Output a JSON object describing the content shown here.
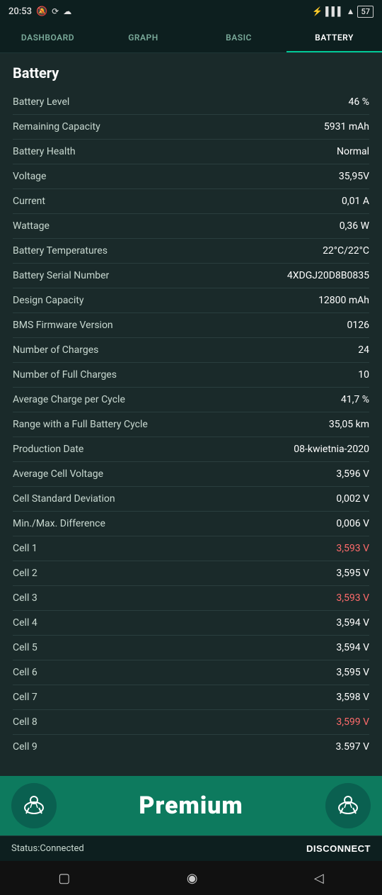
{
  "statusBar": {
    "time": "20:53",
    "batteryPercent": "57"
  },
  "tabs": [
    {
      "id": "dashboard",
      "label": "DASHBOARD",
      "active": false
    },
    {
      "id": "graph",
      "label": "GRAPH",
      "active": false
    },
    {
      "id": "basic",
      "label": "BASIC",
      "active": false
    },
    {
      "id": "battery",
      "label": "BATTERY",
      "active": true
    }
  ],
  "section": {
    "title": "Battery"
  },
  "rows": [
    {
      "label": "Battery Level",
      "value": "46 %",
      "highlight": ""
    },
    {
      "label": "Remaining Capacity",
      "value": "5931 mAh",
      "highlight": ""
    },
    {
      "label": "Battery Health",
      "value": "Normal",
      "highlight": ""
    },
    {
      "label": "Voltage",
      "value": "35,95V",
      "highlight": ""
    },
    {
      "label": "Current",
      "value": "0,01 A",
      "highlight": ""
    },
    {
      "label": "Wattage",
      "value": "0,36 W",
      "highlight": ""
    },
    {
      "label": "Battery Temperatures",
      "value": "22°C/22°C",
      "highlight": ""
    },
    {
      "label": "Battery Serial Number",
      "value": "4XDGJ20D8B0835",
      "highlight": ""
    },
    {
      "label": "Design Capacity",
      "value": "12800 mAh",
      "highlight": ""
    },
    {
      "label": "BMS Firmware Version",
      "value": "0126",
      "highlight": ""
    },
    {
      "label": "Number of Charges",
      "value": "24",
      "highlight": ""
    },
    {
      "label": "Number of Full Charges",
      "value": "10",
      "highlight": ""
    },
    {
      "label": "Average Charge per Cycle",
      "value": "41,7 %",
      "highlight": ""
    },
    {
      "label": "Range with a Full Battery Cycle",
      "value": "35,05 km",
      "highlight": ""
    },
    {
      "label": "Production Date",
      "value": "08-kwietnia-2020",
      "highlight": ""
    },
    {
      "label": "Average Cell Voltage",
      "value": "3,596 V",
      "highlight": ""
    },
    {
      "label": "Cell Standard Deviation",
      "value": "0,002 V",
      "highlight": ""
    },
    {
      "label": "Min./Max. Difference",
      "value": "0,006 V",
      "highlight": ""
    },
    {
      "label": "Cell 1",
      "value": "3,593 V",
      "highlight": "red"
    },
    {
      "label": "Cell 2",
      "value": "3,595 V",
      "highlight": ""
    },
    {
      "label": "Cell 3",
      "value": "3,593 V",
      "highlight": "red"
    },
    {
      "label": "Cell 4",
      "value": "3,594 V",
      "highlight": ""
    },
    {
      "label": "Cell 5",
      "value": "3,594 V",
      "highlight": ""
    },
    {
      "label": "Cell 6",
      "value": "3,595 V",
      "highlight": ""
    },
    {
      "label": "Cell 7",
      "value": "3,598 V",
      "highlight": ""
    },
    {
      "label": "Cell 8",
      "value": "3,599 V",
      "highlight": "red"
    },
    {
      "label": "Cell 9",
      "value": "3.597 V",
      "highlight": ""
    }
  ],
  "premium": {
    "label": "Premium"
  },
  "bottomStatus": {
    "statusLabel": "Status:Connected",
    "disconnectLabel": "DISCONNECT"
  },
  "androidNav": {
    "square": "▢",
    "circle": "◉",
    "back": "◁"
  }
}
